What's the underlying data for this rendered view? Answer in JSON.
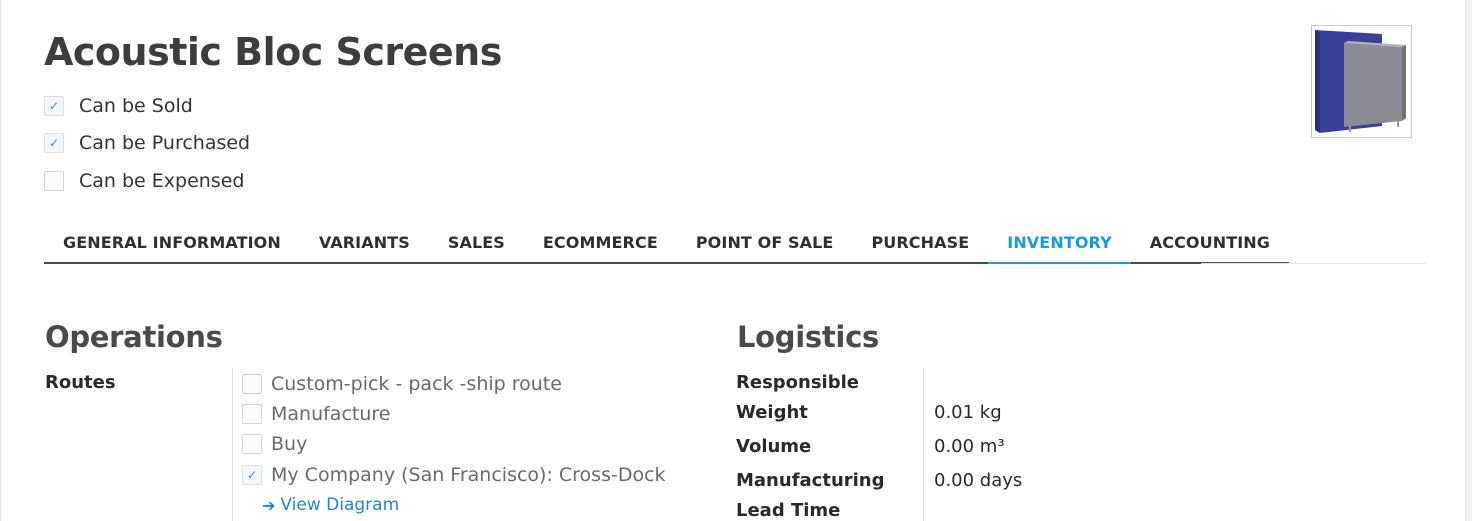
{
  "product": {
    "title": "Acoustic Bloc Screens",
    "image_icon": "product-screen-image"
  },
  "options": [
    {
      "label": "Can be Sold",
      "checked": true
    },
    {
      "label": "Can be Purchased",
      "checked": true
    },
    {
      "label": "Can be Expensed",
      "checked": false
    }
  ],
  "tabs": [
    {
      "label": "GENERAL INFORMATION",
      "active": false
    },
    {
      "label": "VARIANTS",
      "active": false
    },
    {
      "label": "SALES",
      "active": false
    },
    {
      "label": "ECOMMERCE",
      "active": false
    },
    {
      "label": "POINT OF SALE",
      "active": false
    },
    {
      "label": "PURCHASE",
      "active": false
    },
    {
      "label": "INVENTORY",
      "active": true
    },
    {
      "label": "ACCOUNTING",
      "active": false
    }
  ],
  "operations": {
    "title": "Operations",
    "routes_label": "Routes",
    "routes": [
      {
        "label": "Custom-pick - pack -ship route",
        "checked": false
      },
      {
        "label": "Manufacture",
        "checked": false
      },
      {
        "label": "Buy",
        "checked": false
      },
      {
        "label": "My Company (San Francisco): Cross-Dock",
        "checked": true
      }
    ],
    "view_diagram": "View Diagram"
  },
  "logistics": {
    "title": "Logistics",
    "responsible_label": "Responsible",
    "responsible_value": "",
    "weight_label": "Weight",
    "weight_value": "0.01 kg",
    "volume_label": "Volume",
    "volume_value": "0.00 m³",
    "manufacturing_label_1": "Manufacturing",
    "manufacturing_label_2": "Lead Time",
    "manufacturing_value": "0.00 days"
  },
  "colors": {
    "accent": "#1a9ad6",
    "link": "#1f86c9",
    "check": "#2d8fd8"
  }
}
